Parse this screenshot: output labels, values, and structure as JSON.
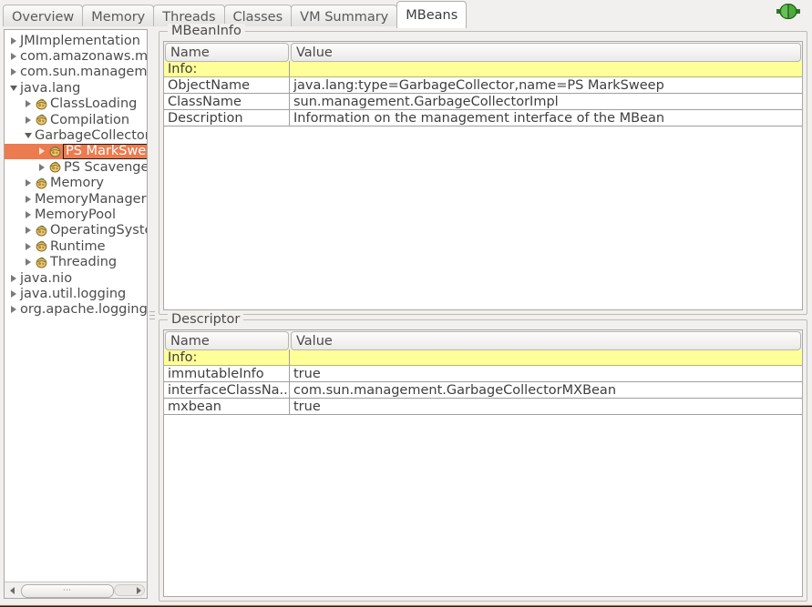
{
  "window": {
    "tabs": [
      {
        "label": "Overview",
        "active": false
      },
      {
        "label": "Memory",
        "active": false
      },
      {
        "label": "Threads",
        "active": false
      },
      {
        "label": "Classes",
        "active": false
      },
      {
        "label": "VM Summary",
        "active": false
      },
      {
        "label": "MBeans",
        "active": true
      }
    ],
    "connection_icon": "connected-plug-icon",
    "accent_selection_color": "#ec7b4f",
    "info_row_color": "#ffff99"
  },
  "tree": {
    "nodes": [
      {
        "label": "JMImplementation",
        "indent": 0,
        "expanded": false,
        "has_handle": true,
        "bean_icon": false,
        "selected": false
      },
      {
        "label": "com.amazonaws.ma",
        "indent": 0,
        "expanded": false,
        "has_handle": true,
        "bean_icon": false,
        "selected": false
      },
      {
        "label": "com.sun.manageme",
        "indent": 0,
        "expanded": false,
        "has_handle": true,
        "bean_icon": false,
        "selected": false
      },
      {
        "label": "java.lang",
        "indent": 0,
        "expanded": true,
        "has_handle": true,
        "bean_icon": false,
        "selected": false
      },
      {
        "label": "ClassLoading",
        "indent": 1,
        "expanded": false,
        "has_handle": true,
        "bean_icon": true,
        "selected": false
      },
      {
        "label": "Compilation",
        "indent": 1,
        "expanded": false,
        "has_handle": true,
        "bean_icon": true,
        "selected": false
      },
      {
        "label": "GarbageCollector",
        "indent": 1,
        "expanded": true,
        "has_handle": true,
        "bean_icon": false,
        "selected": false
      },
      {
        "label": "PS MarkSweep",
        "indent": 2,
        "expanded": false,
        "has_handle": true,
        "bean_icon": true,
        "selected": true
      },
      {
        "label": "PS Scavenge",
        "indent": 2,
        "expanded": false,
        "has_handle": true,
        "bean_icon": true,
        "selected": false
      },
      {
        "label": "Memory",
        "indent": 1,
        "expanded": false,
        "has_handle": true,
        "bean_icon": true,
        "selected": false
      },
      {
        "label": "MemoryManager",
        "indent": 1,
        "expanded": false,
        "has_handle": true,
        "bean_icon": false,
        "selected": false
      },
      {
        "label": "MemoryPool",
        "indent": 1,
        "expanded": false,
        "has_handle": true,
        "bean_icon": false,
        "selected": false
      },
      {
        "label": "OperatingSyste",
        "indent": 1,
        "expanded": false,
        "has_handle": true,
        "bean_icon": true,
        "selected": false
      },
      {
        "label": "Runtime",
        "indent": 1,
        "expanded": false,
        "has_handle": true,
        "bean_icon": true,
        "selected": false
      },
      {
        "label": "Threading",
        "indent": 1,
        "expanded": false,
        "has_handle": true,
        "bean_icon": true,
        "selected": false
      },
      {
        "label": "java.nio",
        "indent": 0,
        "expanded": false,
        "has_handle": true,
        "bean_icon": false,
        "selected": false
      },
      {
        "label": "java.util.logging",
        "indent": 0,
        "expanded": false,
        "has_handle": true,
        "bean_icon": false,
        "selected": false
      },
      {
        "label": "org.apache.logging.",
        "indent": 0,
        "expanded": false,
        "has_handle": true,
        "bean_icon": false,
        "selected": false
      }
    ],
    "hscrollbar": {
      "left_arrow": "scroll-left-icon",
      "right_arrow": "scroll-right-icon",
      "grip": "⋯"
    }
  },
  "mbeaninfo": {
    "title": "MBeanInfo",
    "columns": [
      "Name",
      "Value"
    ],
    "rows": [
      {
        "name": "Info:",
        "value": "",
        "info": true
      },
      {
        "name": "ObjectName",
        "value": "java.lang:type=GarbageCollector,name=PS MarkSweep",
        "info": false
      },
      {
        "name": "ClassName",
        "value": "sun.management.GarbageCollectorImpl",
        "info": false
      },
      {
        "name": "Description",
        "value": "Information on the management interface of the MBean",
        "info": false
      }
    ]
  },
  "descriptor": {
    "title": "Descriptor",
    "columns": [
      "Name",
      "Value"
    ],
    "rows": [
      {
        "name": "Info:",
        "value": "",
        "info": true
      },
      {
        "name": "immutableInfo",
        "value": "true",
        "info": false
      },
      {
        "name": "interfaceClassNa...",
        "value": "com.sun.management.GarbageCollectorMXBean",
        "info": false
      },
      {
        "name": "mxbean",
        "value": "true",
        "info": false
      }
    ]
  }
}
